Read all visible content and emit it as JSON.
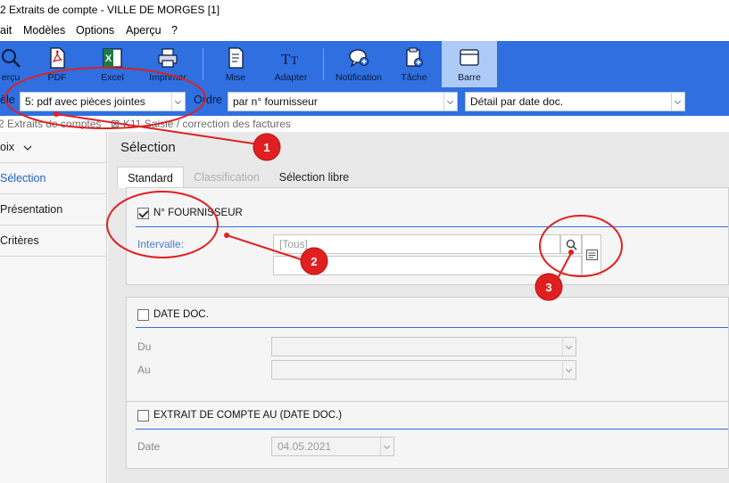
{
  "window": {
    "title": "2 Extraits de compte - VILLE DE MORGES [1]"
  },
  "menu": [
    "ait",
    "Modèles",
    "Options",
    "Aperçu",
    "?"
  ],
  "ribbon": {
    "buttons": [
      {
        "label": "erçu",
        "icon": "preview-icon"
      },
      {
        "label": "PDF",
        "icon": "pdf-icon"
      },
      {
        "label": "Excel",
        "icon": "excel-icon"
      },
      {
        "label": "Imprimer",
        "icon": "printer-icon"
      },
      {
        "label": "Mise",
        "icon": "page-setup-icon"
      },
      {
        "label": "Adapter",
        "icon": "font-size-icon"
      },
      {
        "label": "Notification",
        "icon": "notification-icon"
      },
      {
        "label": "Tâche",
        "icon": "task-icon"
      },
      {
        "label": "Barre",
        "icon": "window-bar-icon"
      }
    ],
    "color": "#2f6fe0"
  },
  "model_row": {
    "model_label": "èle",
    "model_value": "5: pdf avec pièces jointes",
    "order_label": "Ordre",
    "order_value": "par n° fournisseur",
    "detail_value": "Détail par date doc."
  },
  "breadcrumb": {
    "item1": "2 Extraits de comptes",
    "item2": "K11 Saisie / correction des factures"
  },
  "nav": {
    "header": "oix",
    "items": [
      "Sélection",
      "Présentation",
      "Critères"
    ]
  },
  "main": {
    "title": "Sélection",
    "tabs": [
      "Standard",
      "Classification",
      "Sélection libre"
    ],
    "fournisseur": {
      "header": "N° FOURNISSEUR",
      "checked": true,
      "interval_label": "Intervalle:",
      "from_placeholder": "[Tous]"
    },
    "date_doc": {
      "header": "DATE DOC.",
      "checked": false,
      "from_label": "Du",
      "to_label": "Au"
    },
    "extrait": {
      "header": "EXTRAIT DE COMPTE AU (DATE DOC.)",
      "checked": false,
      "date_label": "Date",
      "date_value": "04.05.2021"
    }
  },
  "annotations": {
    "color": "#e02020",
    "badges": [
      "1",
      "2",
      "3"
    ]
  }
}
